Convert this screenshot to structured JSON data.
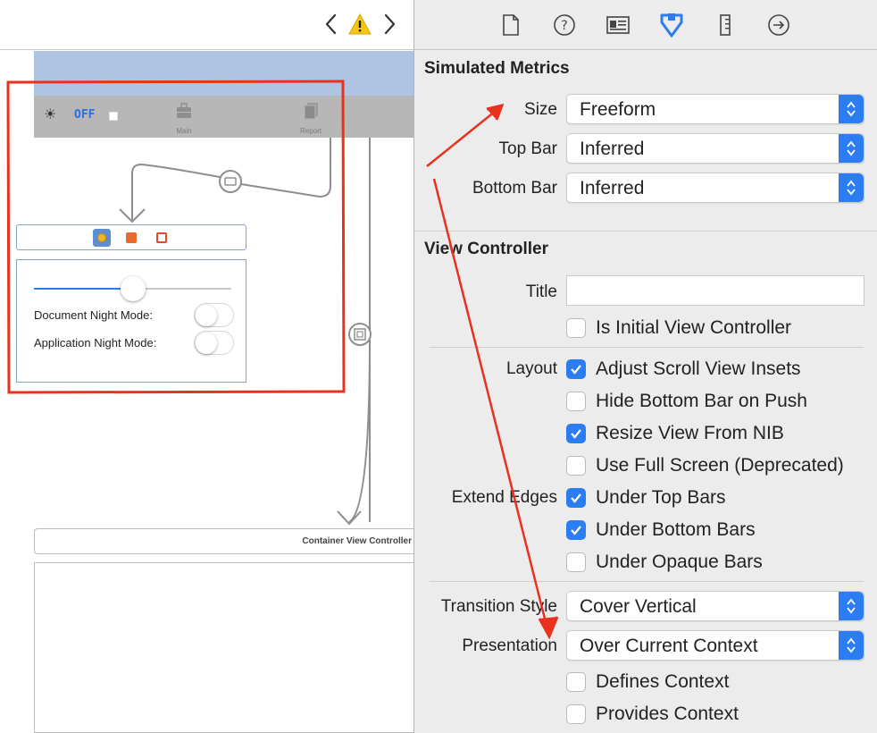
{
  "canvas": {
    "off_label": "OFF",
    "tabs": [
      {
        "label": "Main",
        "icon": "briefcase-icon"
      },
      {
        "label": "Report",
        "icon": "documents-icon"
      }
    ],
    "settings": {
      "document_night_mode": "Document Night Mode:",
      "application_night_mode": "Application Night Mode:",
      "slider_value": 0.5
    },
    "container_title": "Container View Controller"
  },
  "inspector": {
    "simulated_metrics": {
      "heading": "Simulated Metrics",
      "size_label": "Size",
      "size_value": "Freeform",
      "top_bar_label": "Top Bar",
      "top_bar_value": "Inferred",
      "bottom_bar_label": "Bottom Bar",
      "bottom_bar_value": "Inferred"
    },
    "view_controller": {
      "heading": "View Controller",
      "title_label": "Title",
      "title_value": "",
      "is_initial": "Is Initial View Controller",
      "layout_label": "Layout",
      "adjust_scroll": "Adjust Scroll View Insets",
      "hide_bottom_bar": "Hide Bottom Bar on Push",
      "resize_view": "Resize View From NIB",
      "use_full_screen": "Use Full Screen (Deprecated)",
      "extend_edges_label": "Extend Edges",
      "under_top_bars": "Under Top Bars",
      "under_bottom_bars": "Under Bottom Bars",
      "under_opaque_bars": "Under Opaque Bars",
      "transition_style_label": "Transition Style",
      "transition_style_value": "Cover Vertical",
      "presentation_label": "Presentation",
      "presentation_value": "Over Current Context",
      "defines_context": "Defines Context",
      "provides_context": "Provides Context"
    }
  },
  "colors": {
    "accent": "#2c7df2",
    "annotation_red": "#e8321e",
    "warning_yellow": "#f5c518",
    "scene_blue": "#aec4e2"
  }
}
